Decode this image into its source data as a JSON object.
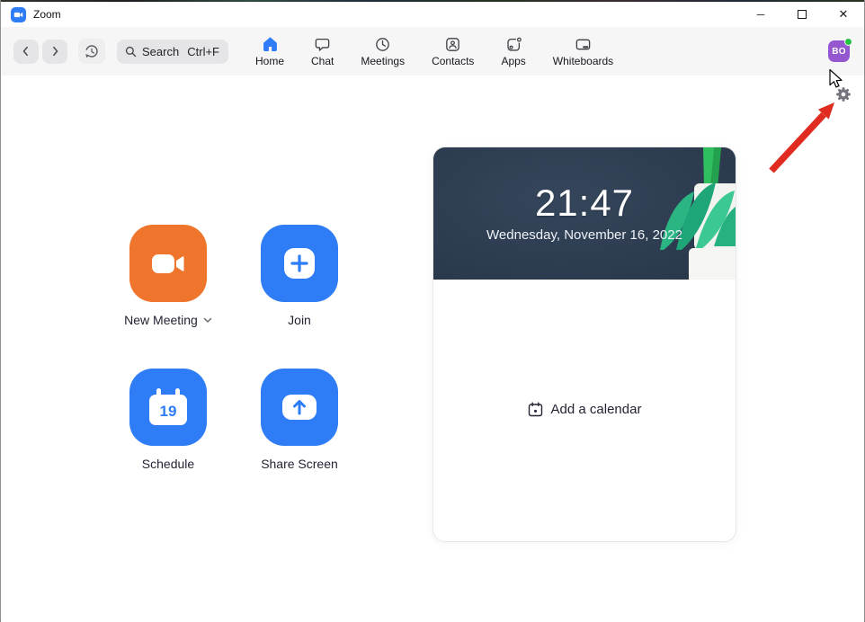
{
  "window": {
    "title": "Zoom",
    "minimize_glyph": "─",
    "close_glyph": "✕"
  },
  "navbar": {
    "back_glyph": "‹",
    "forward_glyph": "›",
    "search_label": "Search",
    "search_shortcut": "Ctrl+F",
    "tabs": [
      {
        "label": "Home",
        "icon": "home-icon",
        "active": true
      },
      {
        "label": "Chat",
        "icon": "chat-icon",
        "active": false
      },
      {
        "label": "Meetings",
        "icon": "meetings-icon",
        "active": false
      },
      {
        "label": "Contacts",
        "icon": "contacts-icon",
        "active": false
      },
      {
        "label": "Apps",
        "icon": "apps-icon",
        "active": false
      },
      {
        "label": "Whiteboards",
        "icon": "whiteboards-icon",
        "active": false
      }
    ],
    "avatar_initials": "BO"
  },
  "home": {
    "actions": [
      {
        "label": "New Meeting",
        "icon": "video-camera-icon",
        "tile_color": "#F0752C",
        "has_dropdown": true
      },
      {
        "label": "Join",
        "icon": "plus-icon",
        "tile_color": "#2E7CF6",
        "has_dropdown": false
      },
      {
        "label": "Schedule",
        "icon": "calendar-icon",
        "tile_color": "#2E7CF6",
        "calendar_day": "19",
        "has_dropdown": false
      },
      {
        "label": "Share Screen",
        "icon": "share-screen-arrow-icon",
        "tile_color": "#2E7CF6",
        "has_dropdown": false
      }
    ],
    "calendar_card": {
      "time": "21:47",
      "date": "Wednesday, November 16, 2022",
      "add_calendar_label": "Add a calendar"
    }
  },
  "annotation": {
    "description": "red arrow pointing at settings gear icon",
    "arrow_color": "#E02B20"
  },
  "colors": {
    "accent_blue": "#2E7CF6",
    "accent_orange": "#F0752C",
    "navbar_bg": "#F6F6F7",
    "card_header_bg": "#2E3D51",
    "avatar_purple": "#9557CF",
    "status_green": "#23C343"
  }
}
